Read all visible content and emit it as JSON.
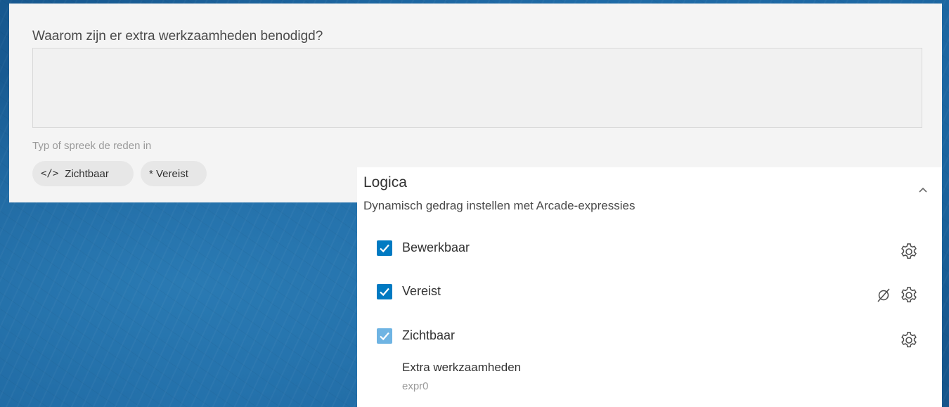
{
  "question": {
    "label": "Waarom zijn er extra werkzaamheden benodigd?",
    "value": "",
    "hint": "Typ of spreek de reden in",
    "chips": {
      "visible": {
        "icon": "code-icon",
        "label": "Zichtbaar"
      },
      "required": {
        "label": "* Vereist"
      }
    }
  },
  "logic": {
    "title": "Logica",
    "subtitle": "Dynamisch gedrag instellen met Arcade-expressies",
    "collapse_icon": "chevron-up-icon",
    "items": [
      {
        "label": "Bewerkbaar",
        "checked": true,
        "state": "enabled"
      },
      {
        "label": "Vereist",
        "checked": true,
        "state": "enabled",
        "extra_icon": "no-symbol-icon"
      },
      {
        "label": "Zichtbaar",
        "checked": true,
        "state": "disabled-appearance",
        "expression": {
          "name": "Extra werkzaamheden",
          "id": "expr0"
        }
      }
    ]
  },
  "colors": {
    "accent": "#007ac2",
    "accent_light": "#6fb4e3",
    "panel_bg": "#ffffff",
    "card_bg": "#f4f4f4"
  }
}
